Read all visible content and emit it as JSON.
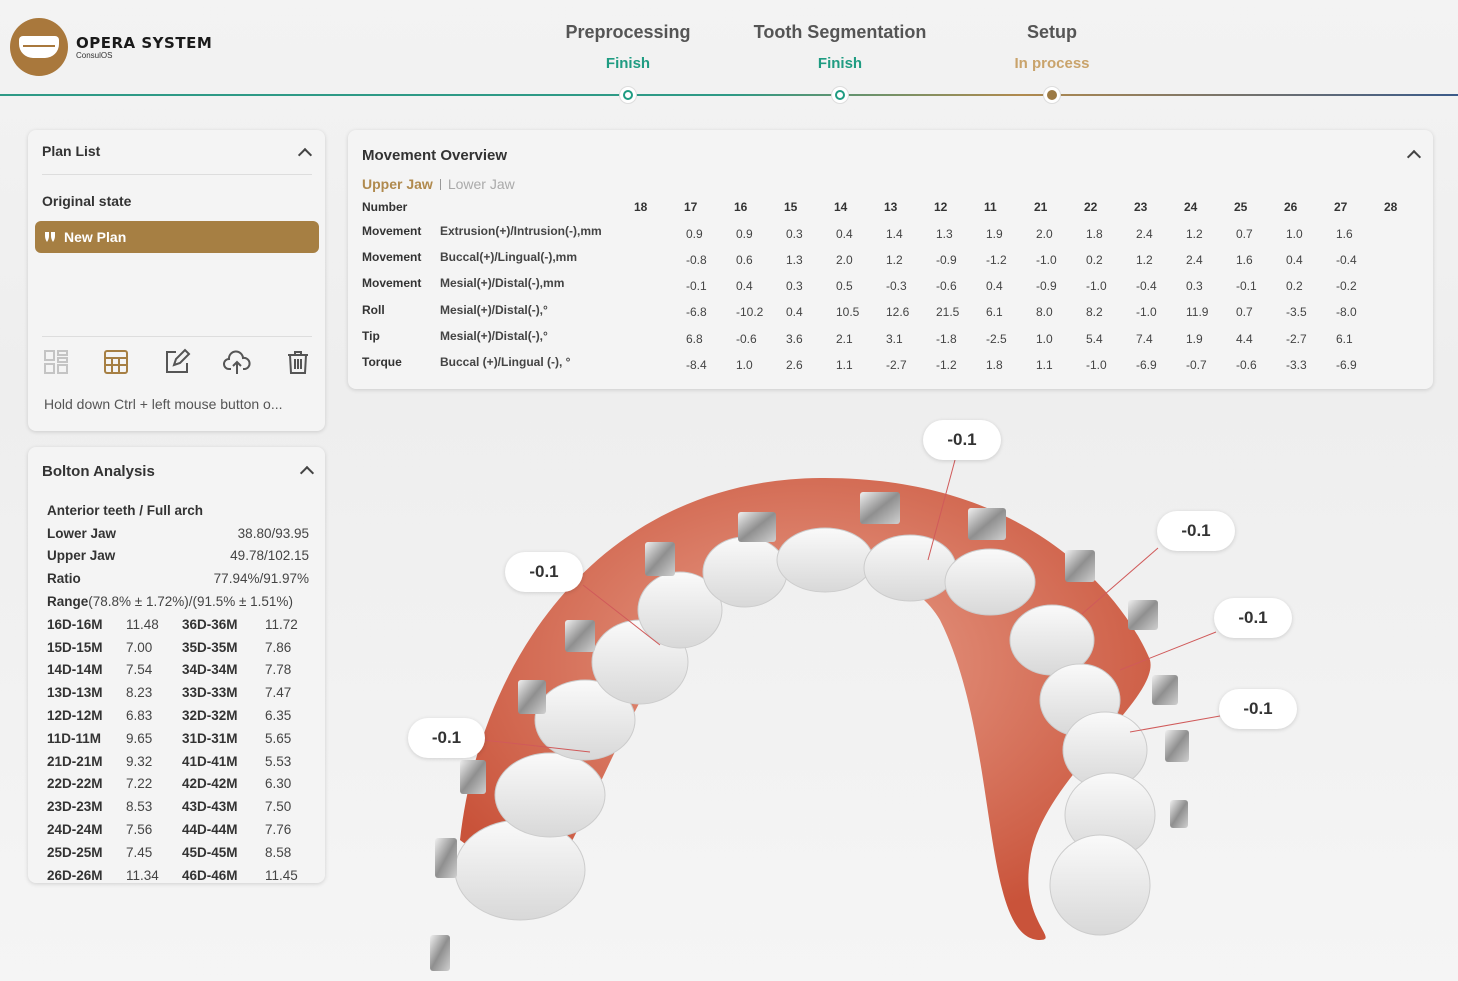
{
  "app": {
    "name": "OPERA SYSTEM",
    "sub": "ConsulOS"
  },
  "steps": [
    {
      "name": "Preprocessing",
      "status": "Finish"
    },
    {
      "name": "Tooth Segmentation",
      "status": "Finish"
    },
    {
      "name": "Setup",
      "status": "In process"
    }
  ],
  "colors": {
    "finish": "#1f9c82",
    "in_process": "#c9a36b",
    "accent": "#a67f43"
  },
  "plan_list": {
    "title": "Plan List",
    "original": "Original state",
    "new_plan": "New Plan",
    "tools": [
      "layout-icon",
      "table-icon",
      "edit-icon",
      "cloud-upload-icon",
      "trash-icon"
    ],
    "hint": "Hold down Ctrl + left mouse button o..."
  },
  "bolton": {
    "title": "Bolton Analysis",
    "header": "Anterior teeth / Full arch",
    "rows": [
      {
        "label": "Lower Jaw",
        "value": "38.80/93.95"
      },
      {
        "label": "Upper Jaw",
        "value": "49.78/102.15"
      },
      {
        "label": "Ratio",
        "value": "77.94%/91.97%"
      }
    ],
    "range_label": "Range",
    "range_value": "(78.8% ± 1.72%)/(91.5% ± 1.51%)",
    "pairs": [
      [
        "16D-16M",
        "11.48",
        "36D-36M",
        "11.72"
      ],
      [
        "15D-15M",
        "7.00",
        "35D-35M",
        "7.86"
      ],
      [
        "14D-14M",
        "7.54",
        "34D-34M",
        "7.78"
      ],
      [
        "13D-13M",
        "8.23",
        "33D-33M",
        "7.47"
      ],
      [
        "12D-12M",
        "6.83",
        "32D-32M",
        "6.35"
      ],
      [
        "11D-11M",
        "9.65",
        "31D-31M",
        "5.65"
      ],
      [
        "21D-21M",
        "9.32",
        "41D-41M",
        "5.53"
      ],
      [
        "22D-22M",
        "7.22",
        "42D-42M",
        "6.30"
      ],
      [
        "23D-23M",
        "8.53",
        "43D-43M",
        "7.50"
      ],
      [
        "24D-24M",
        "7.56",
        "44D-44M",
        "7.76"
      ],
      [
        "25D-25M",
        "7.45",
        "45D-45M",
        "8.58"
      ],
      [
        "26D-26M",
        "11.34",
        "46D-46M",
        "11.45"
      ]
    ]
  },
  "movement": {
    "title": "Movement Overview",
    "tab_upper": "Upper Jaw",
    "tab_lower": "Lower Jaw",
    "number_label": "Number",
    "teeth": [
      "18",
      "17",
      "16",
      "15",
      "14",
      "13",
      "12",
      "11",
      "21",
      "22",
      "23",
      "24",
      "25",
      "26",
      "27",
      "28"
    ],
    "rows": [
      {
        "type": "Movement",
        "desc": "Extrusion(+)/Intrusion(-),mm",
        "values": [
          "",
          "0.9",
          "0.9",
          "0.3",
          "0.4",
          "1.4",
          "1.3",
          "1.9",
          "2.0",
          "1.8",
          "2.4",
          "1.2",
          "0.7",
          "1.0",
          "1.6",
          ""
        ]
      },
      {
        "type": "Movement",
        "desc": "Buccal(+)/Lingual(-),mm",
        "values": [
          "",
          "-0.8",
          "0.6",
          "1.3",
          "2.0",
          "1.2",
          "-0.9",
          "-1.2",
          "-1.0",
          "0.2",
          "1.2",
          "2.4",
          "1.6",
          "0.4",
          "-0.4",
          ""
        ]
      },
      {
        "type": "Movement",
        "desc": "Mesial(+)/Distal(-),mm",
        "values": [
          "",
          "-0.1",
          "0.4",
          "0.3",
          "0.5",
          "-0.3",
          "-0.6",
          "0.4",
          "-0.9",
          "-1.0",
          "-0.4",
          "0.3",
          "-0.1",
          "0.2",
          "-0.2",
          ""
        ]
      },
      {
        "type": "Roll",
        "desc": "Mesial(+)/Distal(-),°",
        "values": [
          "",
          "-6.8",
          "-10.2",
          "0.4",
          "10.5",
          "12.6",
          "21.5",
          "6.1",
          "8.0",
          "8.2",
          "-1.0",
          "11.9",
          "0.7",
          "-3.5",
          "-8.0",
          ""
        ]
      },
      {
        "type": "Tip",
        "desc": "Mesial(+)/Distal(-),°",
        "values": [
          "",
          "6.8",
          "-0.6",
          "3.6",
          "2.1",
          "3.1",
          "-1.8",
          "-2.5",
          "1.0",
          "5.4",
          "7.4",
          "1.9",
          "4.4",
          "-2.7",
          "6.1",
          ""
        ]
      },
      {
        "type": "Torque",
        "desc": "Buccal (+)/Lingual (-), °",
        "values": [
          "",
          "-8.4",
          "1.0",
          "2.6",
          "1.1",
          "-2.7",
          "-1.2",
          "1.8",
          "1.1",
          "-1.0",
          "-6.9",
          "-0.7",
          "-0.6",
          "-3.3",
          "-6.9",
          ""
        ]
      }
    ]
  },
  "scene": {
    "callouts": [
      "-0.1",
      "-0.1",
      "-0.1",
      "-0.1",
      "-0.1",
      "-0.1"
    ]
  }
}
